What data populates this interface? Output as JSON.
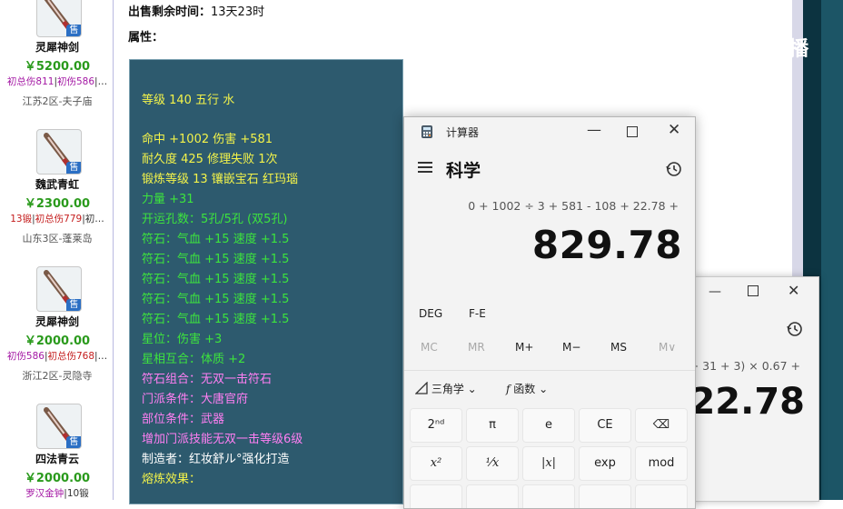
{
  "header": {
    "time_label": "出售剩余时间：",
    "time_value": "13天23时",
    "attr_label": "属性："
  },
  "items": [
    {
      "name": "灵犀神剑",
      "price": "￥5200.00",
      "tags": [
        {
          "t": "初总伤811",
          "c": "p"
        },
        {
          "t": "|",
          "c": "sep"
        },
        {
          "t": "初伤586",
          "c": "p"
        },
        {
          "t": "|…",
          "c": "sep"
        }
      ],
      "server": "江苏2区-夫子庙",
      "sold": "售",
      "icon": "sword-icon"
    },
    {
      "name": "魏武青虹",
      "price": "￥2300.00",
      "tags": [
        {
          "t": "13锻",
          "c": "r"
        },
        {
          "t": "|",
          "c": "sep"
        },
        {
          "t": "初总伤779",
          "c": "r"
        },
        {
          "t": "|初…",
          "c": "sep"
        }
      ],
      "server": "山东3区-蓬莱岛",
      "sold": "售",
      "icon": "sword-icon"
    },
    {
      "name": "灵犀神剑",
      "price": "￥2000.00",
      "tags": [
        {
          "t": "初伤586",
          "c": "p"
        },
        {
          "t": "|",
          "c": "sep"
        },
        {
          "t": "初总伤768",
          "c": "r"
        },
        {
          "t": "|…",
          "c": "sep"
        }
      ],
      "server": "浙江2区-灵隐寺",
      "sold": "售",
      "icon": "sword-icon"
    },
    {
      "name": "四法青云",
      "price": "￥2000.00",
      "tags": [
        {
          "t": "罗汉金钟",
          "c": "p"
        },
        {
          "t": "|",
          "c": "sep"
        },
        {
          "t": "10锻",
          "c": "b"
        }
      ],
      "server": "",
      "sold": "售",
      "icon": "sword-icon"
    }
  ],
  "attributes": [
    {
      "text": "等级 140 五行 水",
      "color": "y"
    },
    {
      "text": "命中 +1002 伤害 +581",
      "color": "y"
    },
    {
      "text": "耐久度 425 修理失败 1次",
      "color": "y"
    },
    {
      "text": "锻炼等级 13 镶嵌宝石 红玛瑙",
      "color": "y"
    },
    {
      "text": "力量 +31",
      "color": "g"
    },
    {
      "text": "开运孔数：5孔/5孔 (双5孔)",
      "color": "g"
    },
    {
      "text": "符石：气血 +15 速度 +1.5",
      "color": "g"
    },
    {
      "text": "符石：气血 +15 速度 +1.5",
      "color": "g"
    },
    {
      "text": "符石：气血 +15 速度 +1.5",
      "color": "g"
    },
    {
      "text": "符石：气血 +15 速度 +1.5",
      "color": "g"
    },
    {
      "text": "符石：气血 +15 速度 +1.5",
      "color": "g"
    },
    {
      "text": "星位：伤害 +3",
      "color": "g"
    },
    {
      "text": "星相互合：体质 +2",
      "color": "g"
    },
    {
      "text": "符石组合：无双一击符石",
      "color": "m"
    },
    {
      "text": "门派条件：大唐官府",
      "color": "m"
    },
    {
      "text": "部位条件：武器",
      "color": "m"
    },
    {
      "text": "增加门派技能无双一击等级6级",
      "color": "m"
    },
    {
      "text": "制造者：红妆舒ル°强化打造",
      "color": "w"
    },
    {
      "text": "熔炼效果：",
      "color": "y"
    }
  ],
  "watermark": {
    "text": "CC直播"
  },
  "calculator": {
    "title": "计算器",
    "mode": "科学",
    "expression": "0 + 1002 ÷ 3 + 581 - 108 + 22.78 +",
    "result": "829.78",
    "deg": "DEG",
    "fe": "F-E",
    "memory": [
      "MC",
      "MR",
      "M+",
      "M−",
      "MS",
      "M∨"
    ],
    "trig_label": "三角学",
    "func_label": "函数",
    "keys_row1": [
      "2ⁿᵈ",
      "π",
      "e",
      "CE",
      "⌫"
    ],
    "keys_row2": [
      "x²",
      "¹⁄x",
      "|x|",
      "exp",
      "mod"
    ]
  },
  "calculator_back": {
    "expression": "0 + 31 + 3) × 0.67 +",
    "result": "22.78"
  }
}
